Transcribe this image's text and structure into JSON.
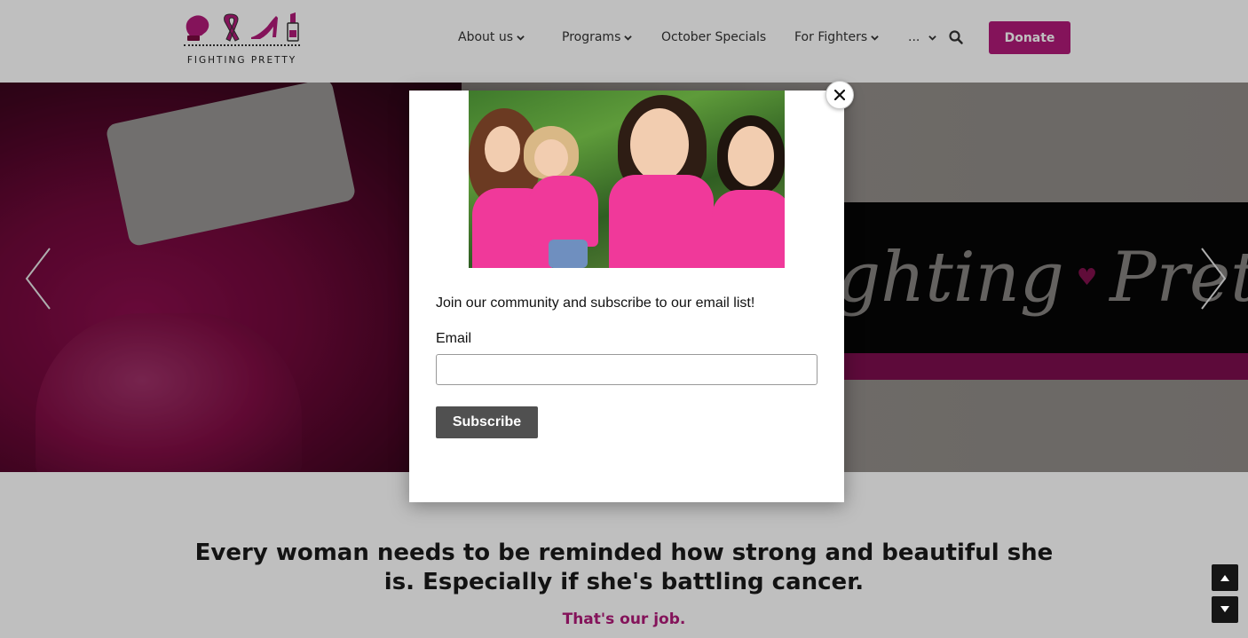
{
  "logo": {
    "text": "FIGHTING PRETTY",
    "icons": [
      "boxing-glove-icon",
      "ribbon-icon",
      "high-heel-icon",
      "lipstick-icon"
    ]
  },
  "nav": {
    "items": [
      {
        "label": "About us",
        "has_dropdown": true
      },
      {
        "label": "Programs",
        "has_dropdown": true
      },
      {
        "label": "October Specials",
        "has_dropdown": false
      },
      {
        "label": "For Fighters",
        "has_dropdown": true
      },
      {
        "label": "...",
        "has_dropdown": true
      }
    ],
    "search_icon": "search-icon",
    "donate_label": "Donate"
  },
  "hero": {
    "banner_text": "Fighting Pretty",
    "prev_icon": "chevron-left-icon",
    "next_icon": "chevron-right-icon"
  },
  "main": {
    "tagline": "Every woman needs to be reminded how strong and beautiful she is. Especially if she's battling cancer.",
    "sub_tagline": "That's our job."
  },
  "modal": {
    "heading": "Join our community and subscribe to our email list!",
    "email_label": "Email",
    "email_value": "",
    "email_placeholder": "",
    "subscribe_label": "Subscribe",
    "close_icon": "close-icon"
  },
  "scroll": {
    "up_icon": "arrow-up-icon",
    "down_icon": "arrow-down-icon"
  },
  "colors": {
    "brand": "#b01a78",
    "brand_bright": "#d01a7d",
    "button_gray": "#505050",
    "dark": "#151515"
  }
}
